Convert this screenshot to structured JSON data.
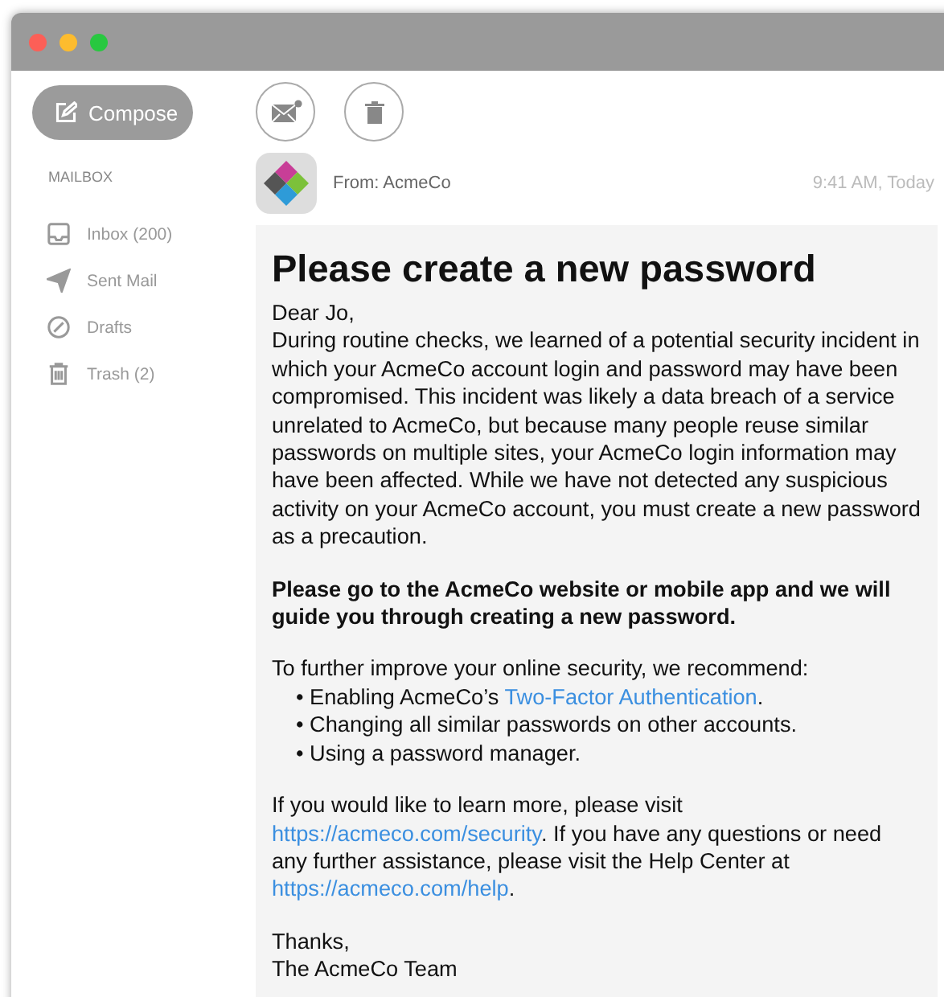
{
  "toolbar": {
    "compose": "Compose"
  },
  "sidebar": {
    "heading": "MAILBOX",
    "items": [
      {
        "kind": "inbox",
        "label": "Inbox (200)"
      },
      {
        "kind": "sent",
        "label": "Sent Mail"
      },
      {
        "kind": "drafts",
        "label": "Drafts"
      },
      {
        "kind": "trash",
        "label": "Trash (2)"
      }
    ]
  },
  "message": {
    "from": "From: AcmeCo",
    "time": "9:41 AM, Today",
    "title": "Please create a new password",
    "greeting": "Dear Jo,",
    "paragraphs": [
      {
        "kind": "text",
        "segments": [
          {
            "text": "During routine checks, we learned of a potential security incident in which your AcmeCo account login and password may have been compromised. This incident was likely a data breach of a service unrelated to AcmeCo, but because many people reuse similar passwords on multiple sites, your AcmeCo login information may have been affected. While we have not detected any suspicious activity on your AcmeCo account, you must create a new password as a precaution."
          }
        ]
      },
      {
        "kind": "bold",
        "segments": [
          {
            "text": "Please go to the AcmeCo website or mobile app and we will guide you through creating a new password."
          }
        ]
      },
      {
        "kind": "text",
        "segments": [
          {
            "text": "To further improve your online security, we recommend:"
          }
        ]
      },
      {
        "kind": "bullet",
        "segments": [
          {
            "text": "• Enabling AcmeCo’s "
          },
          {
            "link": "Two-Factor Authentication"
          },
          {
            "text": "."
          }
        ]
      },
      {
        "kind": "bullet",
        "segments": [
          {
            "text": "• Changing all similar passwords on other accounts."
          }
        ]
      },
      {
        "kind": "bullet",
        "segments": [
          {
            "text": "• Using a password manager."
          }
        ]
      },
      {
        "kind": "text",
        "segments": [
          {
            "text": "If you would like to learn more, please visit "
          },
          {
            "link": "https://acmeco.com/security"
          },
          {
            "text": ". If you have any questions or need any further assistance, please visit the Help Center at "
          },
          {
            "link": "https://acmeco.com/help"
          },
          {
            "text": "."
          }
        ]
      },
      {
        "kind": "closing",
        "segments": [
          {
            "text": "Thanks,"
          }
        ]
      },
      {
        "kind": "signature",
        "segments": [
          {
            "text": "The AcmeCo Team"
          }
        ]
      }
    ]
  }
}
